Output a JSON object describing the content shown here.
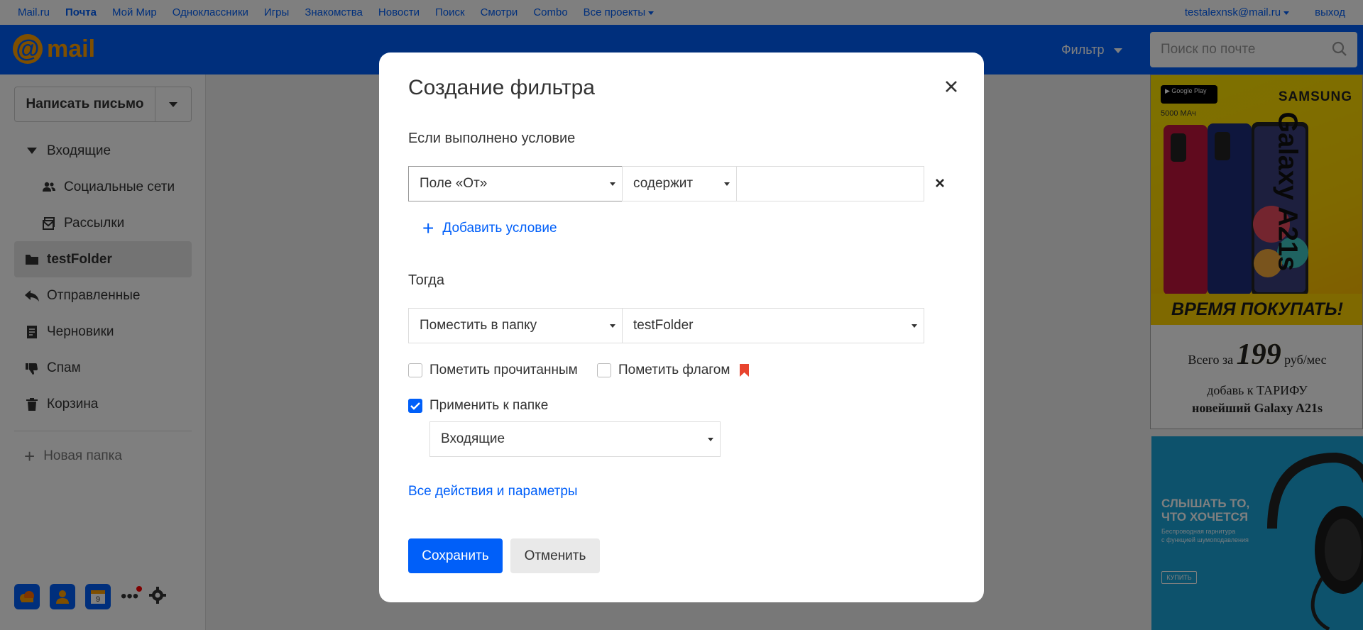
{
  "portal": {
    "links": [
      "Mail.ru",
      "Почта",
      "Мой Мир",
      "Одноклассники",
      "Игры",
      "Знакомства",
      "Новости",
      "Поиск",
      "Смотри",
      "Combo",
      "Все проекты"
    ],
    "user": "testalexnsk@mail.ru",
    "logout": "выход"
  },
  "header": {
    "logo_text": "mail",
    "filter_label": "Фильтр",
    "search_placeholder": "Поиск по почте"
  },
  "sidebar": {
    "compose_label": "Написать письмо",
    "folders": [
      {
        "label": "Входящие",
        "icon": "triangle-down-icon"
      },
      {
        "label": "Социальные сети",
        "icon": "people-icon"
      },
      {
        "label": "Рассылки",
        "icon": "newsletter-icon"
      },
      {
        "label": "testFolder",
        "icon": "folder-icon"
      },
      {
        "label": "Отправленные",
        "icon": "sent-icon"
      },
      {
        "label": "Черновики",
        "icon": "draft-icon"
      },
      {
        "label": "Спам",
        "icon": "thumbs-down-icon"
      },
      {
        "label": "Корзина",
        "icon": "trash-icon"
      }
    ],
    "new_folder": "Новая папка",
    "calendar_day": "9"
  },
  "ads": {
    "ad1": {
      "store": "Google Play",
      "battery": "5000 МАч",
      "brand": "SAMSUNG",
      "model": "Galaxy A21s",
      "slogan": "ВРЕМЯ ПОКУПАТЬ!",
      "price_prefix": "Всего за",
      "price": "199",
      "price_suffix": "руб/мес",
      "line1": "добавь к ТАРИФУ",
      "line2": "новейший Galaxy A21s"
    },
    "ad2": {
      "headline1": "СЛЫШАТЬ ТО,",
      "headline2": "ЧТО ХОЧЕТСЯ",
      "text1": "Беспроводная гарнитура",
      "text2": "с функцией шумоподавления",
      "button": "КУПИТЬ"
    }
  },
  "modal": {
    "title": "Создание фильтра",
    "condition_heading": "Если выполнено условие",
    "condition_field": "Поле «От»",
    "condition_op": "содержит",
    "condition_value": "",
    "add_condition": "Добавить условие",
    "then_heading": "Тогда",
    "action": "Поместить в папку",
    "action_target": "testFolder",
    "mark_read": "Пометить прочитанным",
    "mark_read_checked": false,
    "mark_flag": "Пометить флагом",
    "mark_flag_checked": false,
    "apply_folder": "Применить к папке",
    "apply_folder_checked": true,
    "apply_folder_value": "Входящие",
    "all_actions_link": "Все действия и параметры",
    "save": "Сохранить",
    "cancel": "Отменить",
    "flag_color": "#e8442e"
  },
  "colors": {
    "accent": "#005ff9",
    "brand_orange": "#ff9e00"
  }
}
